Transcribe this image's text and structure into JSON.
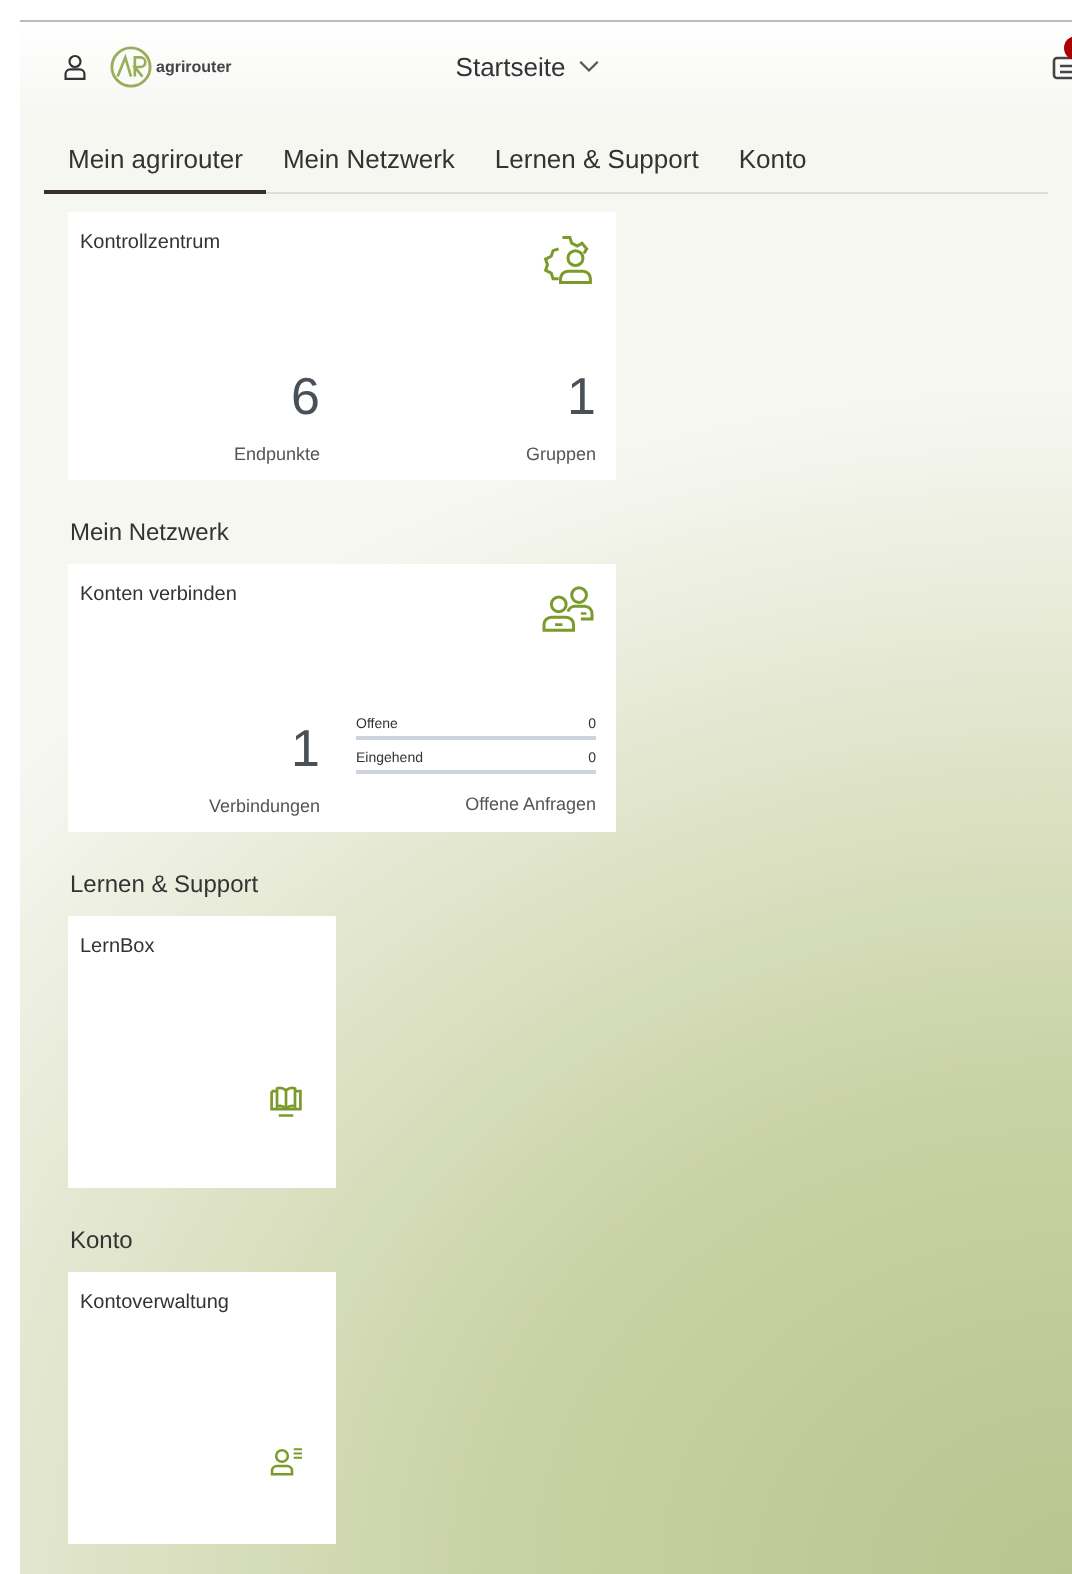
{
  "header": {
    "logo_text": "agrirouter",
    "title": "Startseite",
    "notification_badge": true
  },
  "tabs": [
    {
      "label": "Mein agrirouter",
      "selected": true
    },
    {
      "label": "Mein Netzwerk",
      "selected": false
    },
    {
      "label": "Lernen & Support",
      "selected": false
    },
    {
      "label": "Konto",
      "selected": false
    }
  ],
  "sections": [
    {
      "tiles": [
        {
          "kind": "control-center",
          "title": "Kontrollzentrum",
          "stats": [
            {
              "value": "6",
              "label": "Endpunkte"
            },
            {
              "value": "1",
              "label": "Gruppen"
            }
          ]
        }
      ]
    },
    {
      "heading": "Mein Netzwerk",
      "tiles": [
        {
          "kind": "connections",
          "title": "Konten verbinden",
          "stats": [
            {
              "value": "1",
              "label": "Verbindungen"
            }
          ],
          "requests_label": "Offene Anfragen",
          "requests": [
            {
              "label": "Offene",
              "count": "0",
              "level": 0
            },
            {
              "label": "Eingehend",
              "count": "0",
              "level": 0
            }
          ]
        }
      ]
    },
    {
      "heading": "Lernen & Support",
      "tiles": [
        {
          "kind": "learning",
          "title": "LernBox"
        }
      ]
    },
    {
      "heading": "Konto",
      "tiles": [
        {
          "kind": "account",
          "title": "Kontoverwaltung"
        }
      ]
    }
  ]
}
